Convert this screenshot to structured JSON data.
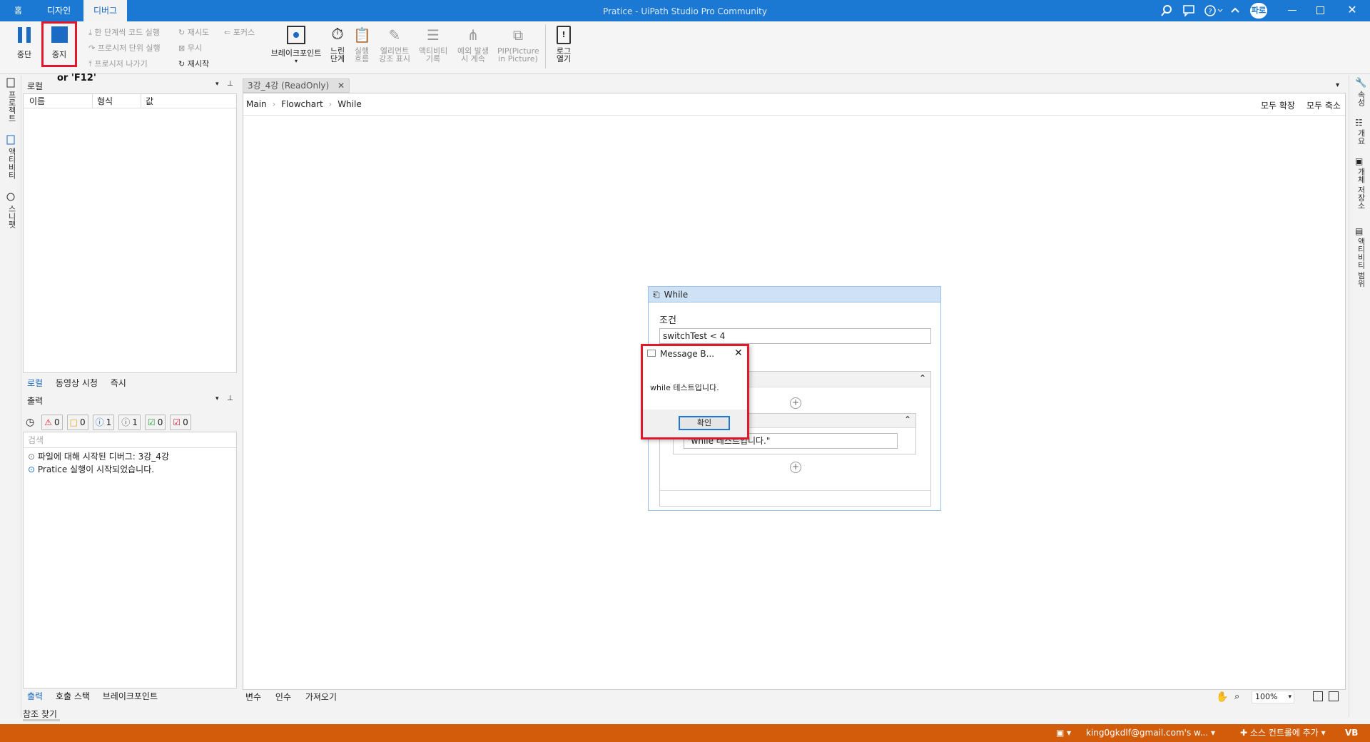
{
  "titlebar": {
    "tabs": [
      "홈",
      "디자인",
      "디버그"
    ],
    "active_tab": "디버그",
    "window_title": "Pratice - UiPath Studio Pro Community",
    "user": "파로"
  },
  "ribbon": {
    "pause": "중단",
    "stop": "중지",
    "stop_hint": "or 'F12'",
    "step_into": "한 단계씩 코드 실행",
    "step_over": "프로시저 단위 실행",
    "step_out": "프로시저 나가기",
    "retry": "재시도",
    "ignore": "무시",
    "restart": "재시작",
    "focus": "포커스",
    "breakpoints": "브레이크포인트",
    "slow_step": "느린 단계",
    "execution_trail": "실행 흐름",
    "highlight_elements": "엘리먼트 강조 표시",
    "log_activities": "액티비티 기록",
    "continue_on_exception": "예외 발생 시 계속",
    "pip": "PIP(Picture in Picture)",
    "open_logs": "로그 열기"
  },
  "left_sidebar": [
    "프로젝트",
    "액티비티",
    "스니펫"
  ],
  "right_sidebar": [
    "속성",
    "개요",
    "개체 저장소",
    "액티비티 범위"
  ],
  "locals_panel": {
    "title": "로컬",
    "columns": [
      "이름",
      "형식",
      "값"
    ],
    "tabs": [
      "로컬",
      "동영상 시청",
      "즉시"
    ],
    "active_tab": "로컬"
  },
  "output_panel": {
    "title": "출력",
    "filters": [
      {
        "icon": "error-icon",
        "count": "0",
        "color": "#e0182b"
      },
      {
        "icon": "warning-icon",
        "count": "0",
        "color": "#e8a317"
      },
      {
        "icon": "info-icon",
        "count": "1",
        "color": "#1b6ac3"
      },
      {
        "icon": "trace-icon",
        "count": "1",
        "color": "#555555"
      },
      {
        "icon": "success-icon",
        "count": "0",
        "color": "#2a9d3a"
      },
      {
        "icon": "verbose-icon",
        "count": "0",
        "color": "#c8243c"
      }
    ],
    "search_placeholder": "검색",
    "log_lines": [
      "파일에 대해 시작된 디버그: 3강_4강",
      "Pratice 실행이 시작되었습니다."
    ],
    "tabs": [
      "출력",
      "호출 스택",
      "브레이크포인트"
    ],
    "active_tab": "출력"
  },
  "find_references": "참조 찾기",
  "document": {
    "tab_label": "3강_4강 (ReadOnly)",
    "breadcrumb": [
      "Main",
      "Flowchart",
      "While"
    ],
    "expand_all": "모두 확장",
    "collapse_all": "모두 축소",
    "bottom_tabs": [
      "변수",
      "인수",
      "가져오기"
    ],
    "zoom": "100%"
  },
  "while_activity": {
    "title": "While",
    "condition_label": "조건",
    "condition_value": "switchTest < 4",
    "message_text": "\"while 테스트입니다.\""
  },
  "message_box": {
    "title": "Message B...",
    "body": "while 테스트입니다.",
    "ok": "확인"
  },
  "statusbar": {
    "account": "king0gkdlf@gmail.com's w...",
    "source_control": "소스 컨트롤에 추가",
    "language": "VB"
  }
}
